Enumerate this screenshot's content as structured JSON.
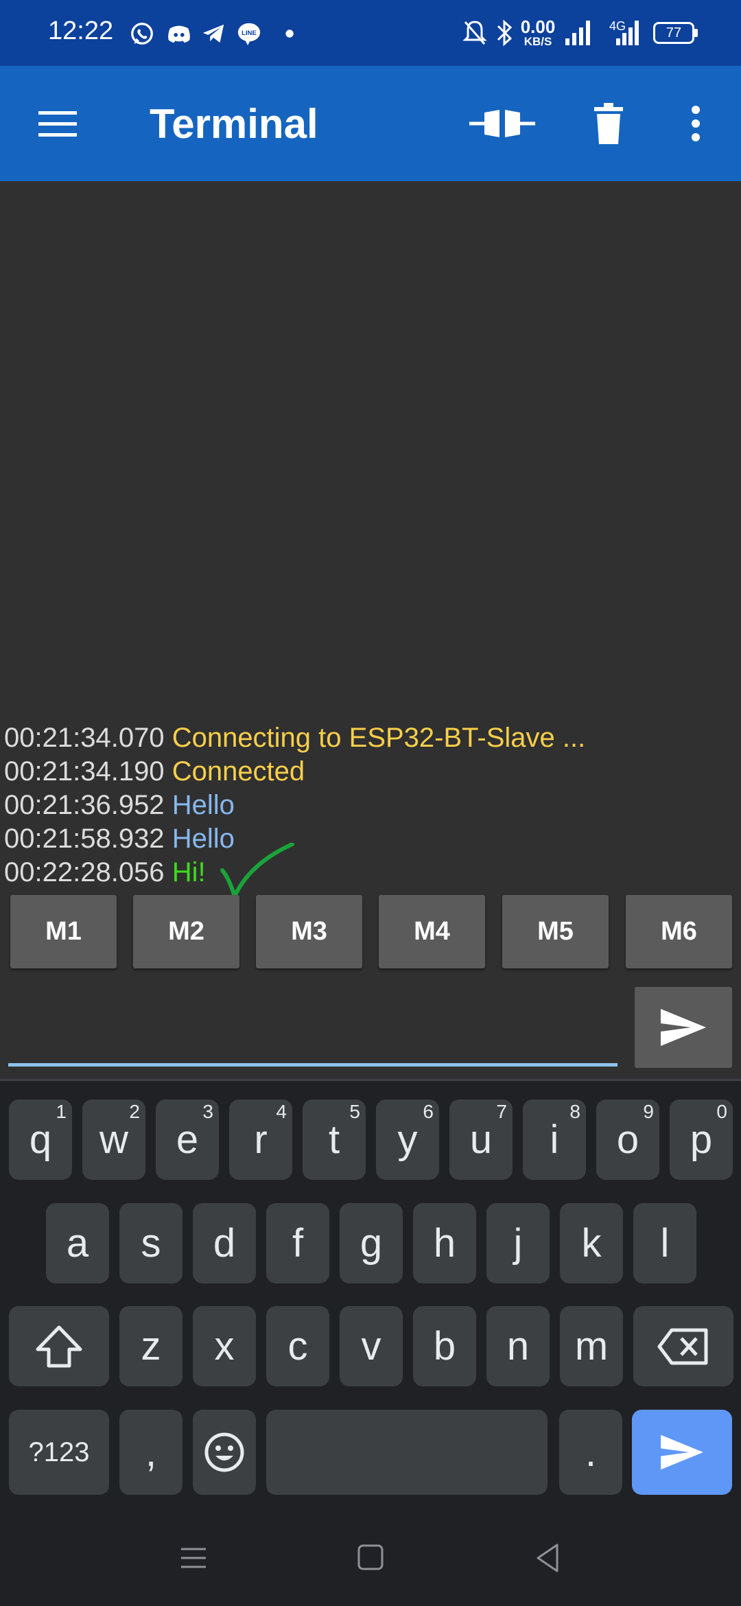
{
  "status_bar": {
    "time": "12:22",
    "net_speed_value": "0.00",
    "net_speed_unit": "KB/S",
    "network_type": "4G",
    "battery": "77",
    "app_icons": [
      "whatsapp-icon",
      "discord-icon",
      "telegram-icon",
      "line-icon",
      "dot-icon"
    ],
    "line_badge": "LINE"
  },
  "app_bar": {
    "title": "Terminal",
    "icons": [
      "menu-icon",
      "connect-icon",
      "delete-icon",
      "more-icon"
    ]
  },
  "terminal": {
    "lines": [
      {
        "timestamp": "00:21:34.070",
        "message": "Connecting to ESP32-BT-Slave ...",
        "kind": "status"
      },
      {
        "timestamp": "00:21:34.190",
        "message": "Connected",
        "kind": "status"
      },
      {
        "timestamp": "00:21:36.952",
        "message": "Hello",
        "kind": "received"
      },
      {
        "timestamp": "00:21:58.932",
        "message": "Hello",
        "kind": "received"
      },
      {
        "timestamp": "00:22:28.056",
        "message": "Hi!",
        "kind": "sent"
      }
    ],
    "colors": {
      "status": "#f9cf4a",
      "received": "#86b8ee",
      "sent": "#3ddc1c",
      "timestamp": "#dcdcdc"
    }
  },
  "macros": [
    "M1",
    "M2",
    "M3",
    "M4",
    "M5",
    "M6"
  ],
  "input": {
    "value": "",
    "placeholder": ""
  },
  "keyboard": {
    "row1": [
      {
        "k": "q",
        "h": "1"
      },
      {
        "k": "w",
        "h": "2"
      },
      {
        "k": "e",
        "h": "3"
      },
      {
        "k": "r",
        "h": "4"
      },
      {
        "k": "t",
        "h": "5"
      },
      {
        "k": "y",
        "h": "6"
      },
      {
        "k": "u",
        "h": "7"
      },
      {
        "k": "i",
        "h": "8"
      },
      {
        "k": "o",
        "h": "9"
      },
      {
        "k": "p",
        "h": "0"
      }
    ],
    "row2": [
      "a",
      "s",
      "d",
      "f",
      "g",
      "h",
      "j",
      "k",
      "l"
    ],
    "row3": [
      "z",
      "x",
      "c",
      "v",
      "b",
      "n",
      "m"
    ],
    "symbols_label": "?123",
    "comma": ",",
    "period": ".",
    "enter_color": "#5e97f6"
  },
  "nav_bar": {
    "icons": [
      "recents-icon",
      "home-icon",
      "back-icon"
    ]
  }
}
